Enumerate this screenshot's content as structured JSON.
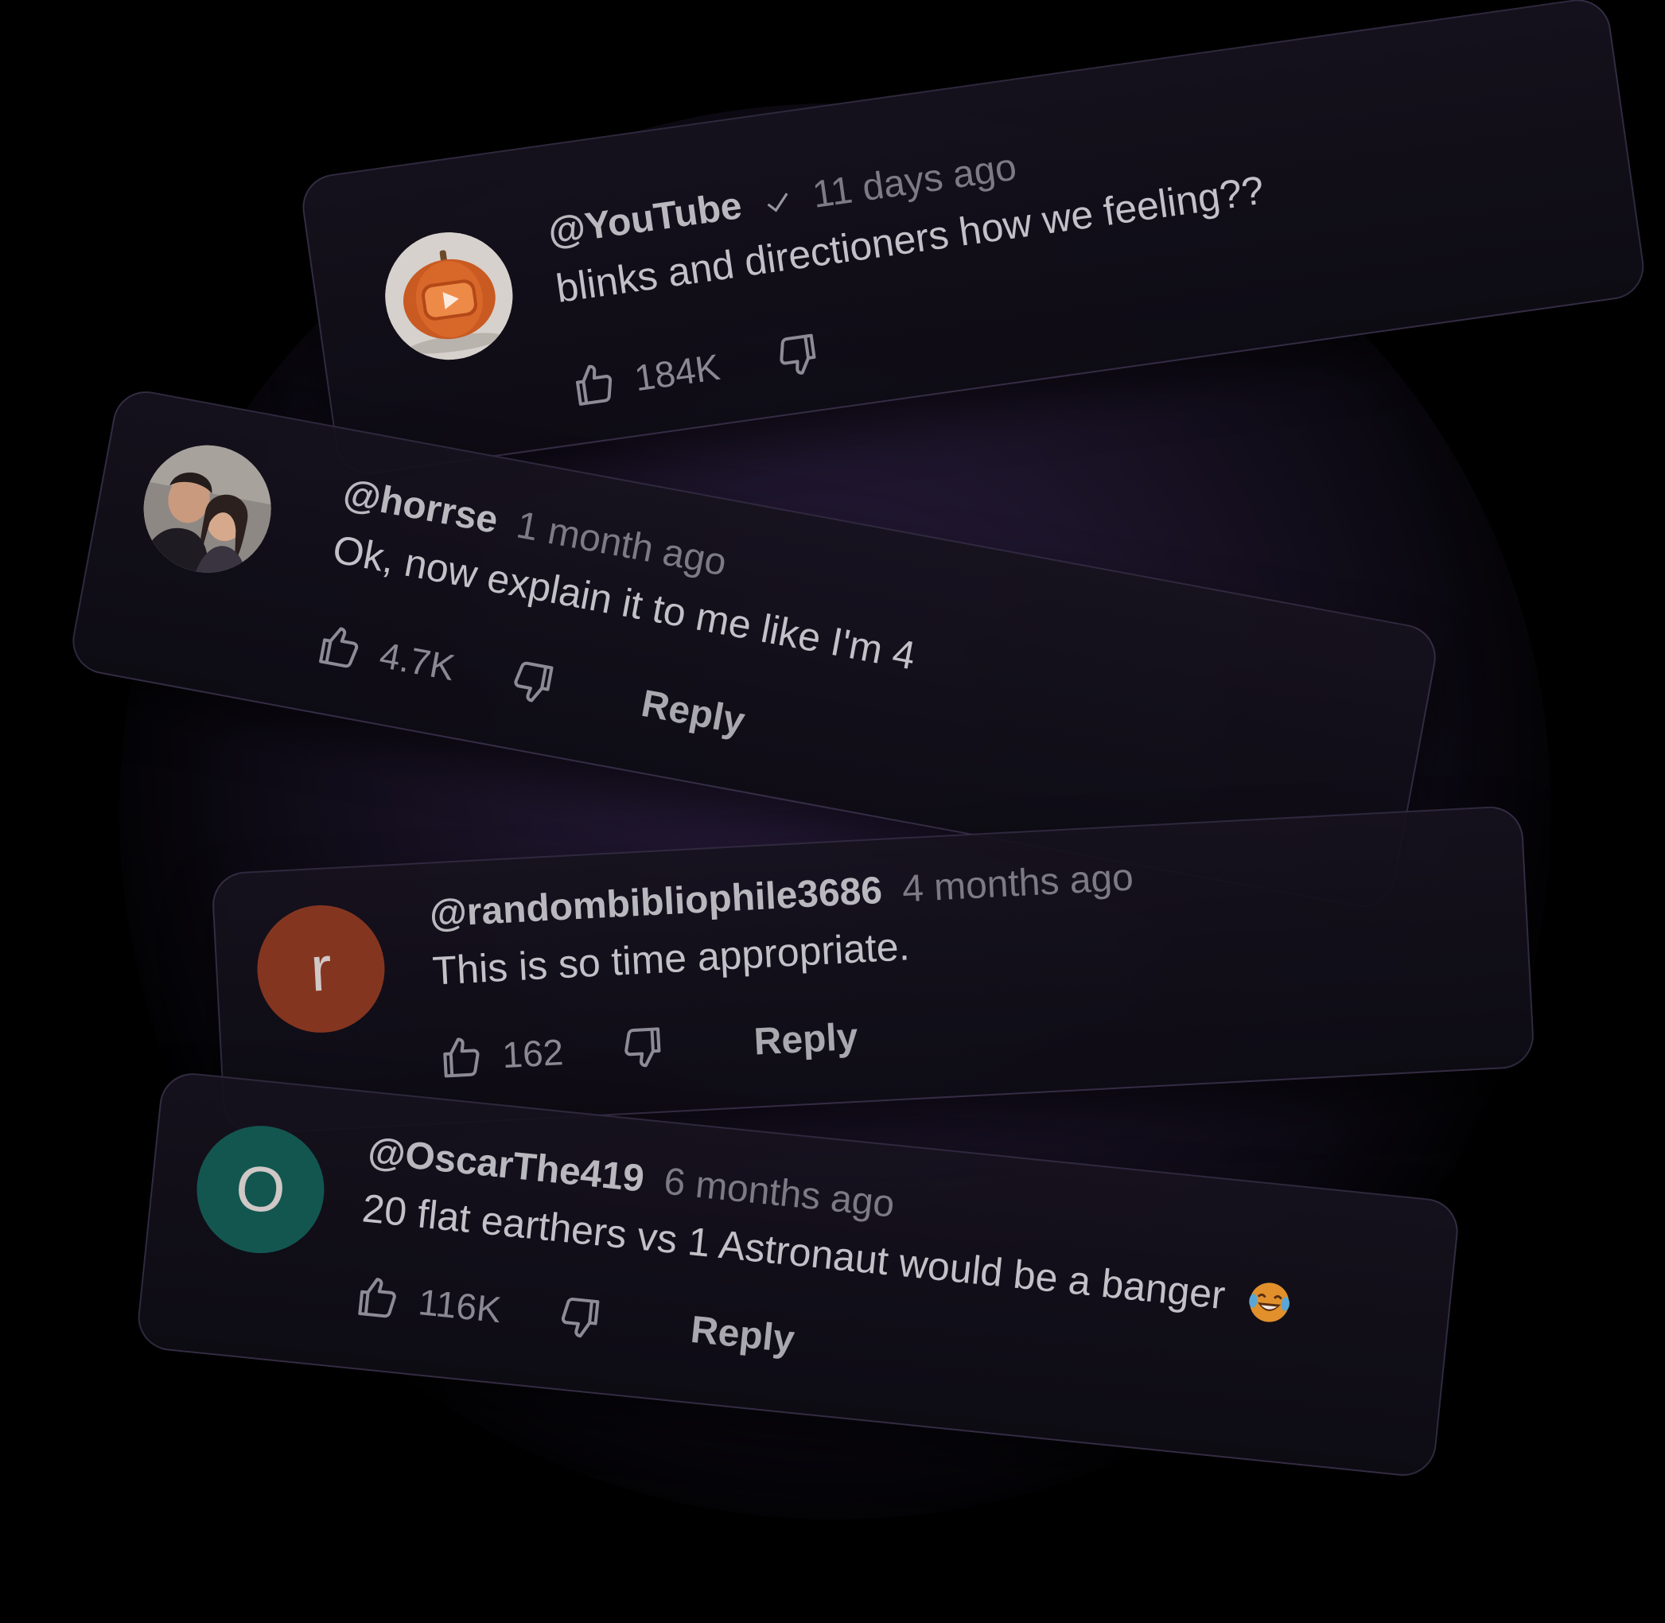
{
  "comments": [
    {
      "handle": "@YouTube",
      "verified": true,
      "time": "11 days ago",
      "text": "blinks and directioners how we feeling??",
      "likes": "184K",
      "reply": "",
      "avatar": {
        "type": "image",
        "description_icon": "pumpkin-play-icon",
        "bg": "#d9d4cf",
        "accent": "#e0672a"
      }
    },
    {
      "handle": "@horrse",
      "verified": false,
      "time": "1 month ago",
      "text": "Ok, now explain it to me like I'm 4",
      "likes": "4.7K",
      "reply": "Reply",
      "avatar": {
        "type": "image",
        "description_icon": "couple-photo-icon",
        "bg": "#8f8a86",
        "accent": "#3a2f2b"
      }
    },
    {
      "handle": "@randombibliophile3686",
      "verified": false,
      "time": "4 months ago",
      "text": "This is so time appropriate.",
      "likes": "162",
      "reply": "Reply",
      "avatar": {
        "type": "letter",
        "letter": "r",
        "bg": "#843520"
      }
    },
    {
      "handle": "@OscarThe419",
      "verified": false,
      "time": "6 months ago",
      "text": "20 flat earthers vs 1 Astronaut would be a banger",
      "emoji": "laughing-tears-emoji",
      "likes": "116K",
      "reply": "Reply",
      "avatar": {
        "type": "letter",
        "letter": "O",
        "bg": "#135650"
      }
    }
  ],
  "icons": {
    "like": "thumbs-up-icon",
    "dislike": "thumbs-down-icon",
    "verified": "checkmark-icon"
  }
}
